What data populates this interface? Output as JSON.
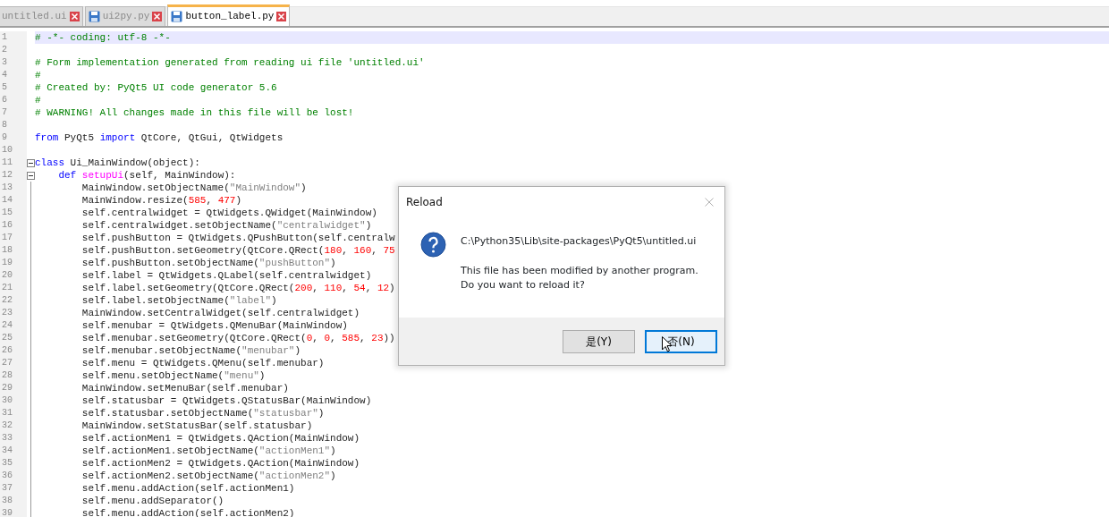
{
  "tabs": [
    {
      "label": "untitled.ui",
      "selected": false,
      "file_icon": false
    },
    {
      "label": "ui2py.py",
      "selected": false,
      "file_icon": true
    },
    {
      "label": "button_label.py",
      "selected": true,
      "file_icon": true
    }
  ],
  "editor": {
    "lines": [
      {
        "number": "1",
        "current": true,
        "segments": [
          {
            "text": "# -*- coding: utf-8 -*-",
            "kind": "comment"
          }
        ]
      },
      {
        "number": "2",
        "current": false
      },
      {
        "number": "3",
        "current": false,
        "segments": [
          {
            "text": "# Form implementation generated from reading ui file 'untitled.ui'",
            "kind": "comment"
          }
        ]
      },
      {
        "number": "4",
        "current": false,
        "segments": [
          {
            "text": "#",
            "kind": "comment"
          }
        ]
      },
      {
        "number": "5",
        "current": false,
        "segments": [
          {
            "text": "# Created by: PyQt5 UI code generator 5.6",
            "kind": "comment"
          }
        ]
      },
      {
        "number": "6",
        "current": false,
        "segments": [
          {
            "text": "#",
            "kind": "comment"
          }
        ]
      },
      {
        "number": "7",
        "current": false,
        "segments": [
          {
            "text": "# WARNING! All changes made in this file will be lost!",
            "kind": "comment"
          }
        ]
      },
      {
        "number": "8",
        "current": false
      },
      {
        "number": "9",
        "current": false,
        "segments": [
          {
            "text": "from",
            "kind": "keyword"
          },
          {
            "text": " PyQt5 ",
            "kind": "plain"
          },
          {
            "text": "import",
            "kind": "keyword"
          },
          {
            "text": " QtCore, QtGui, QtWidgets",
            "kind": "plain"
          }
        ]
      },
      {
        "number": "10",
        "current": false
      },
      {
        "number": "11",
        "current": false,
        "expanded": true,
        "segments": [
          {
            "text": "class",
            "kind": "keyword"
          },
          {
            "text": " Ui_MainWindow(object):",
            "kind": "plain"
          }
        ],
        "children": [
          {
            "number": "12",
            "current": false,
            "expanded": true,
            "segments": [
              {
                "text": "def",
                "kind": "keyword"
              },
              {
                "text": " setupUi",
                "kind": "function"
              },
              {
                "text": "(self, MainWindow):",
                "kind": "plain"
              }
            ],
            "children": [
              {
                "number": "13",
                "current": false,
                "segments": [
                  {
                    "text": "MainWindow.setObjectName(",
                    "kind": "plain"
                  },
                  {
                    "text": "\"MainWindow\"",
                    "kind": "string"
                  },
                  {
                    "text": ")",
                    "kind": "plain"
                  }
                ]
              },
              {
                "number": "14",
                "current": false,
                "segments": [
                  {
                    "text": "MainWindow.resize(",
                    "kind": "plain"
                  },
                  {
                    "text": "585",
                    "kind": "number"
                  },
                  {
                    "text": ", ",
                    "kind": "plain"
                  },
                  {
                    "text": "477",
                    "kind": "number"
                  },
                  {
                    "text": ")",
                    "kind": "plain"
                  }
                ]
              },
              {
                "number": "15",
                "current": false,
                "segments": [
                  {
                    "text": "self.centralwidget = QtWidgets.QWidget(MainWindow)",
                    "kind": "plain"
                  }
                ]
              },
              {
                "number": "16",
                "current": false,
                "segments": [
                  {
                    "text": "self.centralwidget.setObjectName(",
                    "kind": "plain"
                  },
                  {
                    "text": "\"centralwidget\"",
                    "kind": "string"
                  },
                  {
                    "text": ")",
                    "kind": "plain"
                  }
                ]
              },
              {
                "number": "17",
                "current": false,
                "segments": [
                  {
                    "text": "self.pushButton = QtWidgets.QPushButton(self.centralw",
                    "kind": "plain"
                  }
                ]
              },
              {
                "number": "18",
                "current": false,
                "segments": [
                  {
                    "text": "self.pushButton.setGeometry(QtCore.QRect(",
                    "kind": "plain"
                  },
                  {
                    "text": "180",
                    "kind": "number"
                  },
                  {
                    "text": ", ",
                    "kind": "plain"
                  },
                  {
                    "text": "160",
                    "kind": "number"
                  },
                  {
                    "text": ", ",
                    "kind": "plain"
                  },
                  {
                    "text": "75",
                    "kind": "number"
                  }
                ]
              },
              {
                "number": "19",
                "current": false,
                "segments": [
                  {
                    "text": "self.pushButton.setObjectName(",
                    "kind": "plain"
                  },
                  {
                    "text": "\"pushButton\"",
                    "kind": "string"
                  },
                  {
                    "text": ")",
                    "kind": "plain"
                  }
                ]
              },
              {
                "number": "20",
                "current": false,
                "segments": [
                  {
                    "text": "self.label = QtWidgets.QLabel(self.centralwidget)",
                    "kind": "plain"
                  }
                ]
              },
              {
                "number": "21",
                "current": false,
                "segments": [
                  {
                    "text": "self.label.setGeometry(QtCore.QRect(",
                    "kind": "plain"
                  },
                  {
                    "text": "200",
                    "kind": "number"
                  },
                  {
                    "text": ", ",
                    "kind": "plain"
                  },
                  {
                    "text": "110",
                    "kind": "number"
                  },
                  {
                    "text": ", ",
                    "kind": "plain"
                  },
                  {
                    "text": "54",
                    "kind": "number"
                  },
                  {
                    "text": ", ",
                    "kind": "plain"
                  },
                  {
                    "text": "12",
                    "kind": "number"
                  },
                  {
                    "text": ")",
                    "kind": "plain"
                  }
                ]
              },
              {
                "number": "22",
                "current": false,
                "segments": [
                  {
                    "text": "self.label.setObjectName(",
                    "kind": "plain"
                  },
                  {
                    "text": "\"label\"",
                    "kind": "string"
                  },
                  {
                    "text": ")",
                    "kind": "plain"
                  }
                ]
              },
              {
                "number": "23",
                "current": false,
                "segments": [
                  {
                    "text": "MainWindow.setCentralWidget(self.centralwidget)",
                    "kind": "plain"
                  }
                ]
              },
              {
                "number": "24",
                "current": false,
                "segments": [
                  {
                    "text": "self.menubar = QtWidgets.QMenuBar(MainWindow)",
                    "kind": "plain"
                  }
                ]
              },
              {
                "number": "25",
                "current": false,
                "segments": [
                  {
                    "text": "self.menubar.setGeometry(QtCore.QRect(",
                    "kind": "plain"
                  },
                  {
                    "text": "0",
                    "kind": "number"
                  },
                  {
                    "text": ", ",
                    "kind": "plain"
                  },
                  {
                    "text": "0",
                    "kind": "number"
                  },
                  {
                    "text": ", ",
                    "kind": "plain"
                  },
                  {
                    "text": "585",
                    "kind": "number"
                  },
                  {
                    "text": ", ",
                    "kind": "plain"
                  },
                  {
                    "text": "23",
                    "kind": "number"
                  },
                  {
                    "text": "))",
                    "kind": "plain"
                  }
                ]
              },
              {
                "number": "26",
                "current": false,
                "segments": [
                  {
                    "text": "self.menubar.setObjectName(",
                    "kind": "plain"
                  },
                  {
                    "text": "\"menubar\"",
                    "kind": "string"
                  },
                  {
                    "text": ")",
                    "kind": "plain"
                  }
                ]
              },
              {
                "number": "27",
                "current": false,
                "segments": [
                  {
                    "text": "self.menu = QtWidgets.QMenu(self.menubar)",
                    "kind": "plain"
                  }
                ]
              },
              {
                "number": "28",
                "current": false,
                "segments": [
                  {
                    "text": "self.menu.setObjectName(",
                    "kind": "plain"
                  },
                  {
                    "text": "\"menu\"",
                    "kind": "string"
                  },
                  {
                    "text": ")",
                    "kind": "plain"
                  }
                ]
              },
              {
                "number": "29",
                "current": false,
                "segments": [
                  {
                    "text": "MainWindow.setMenuBar(self.menubar)",
                    "kind": "plain"
                  }
                ]
              },
              {
                "number": "30",
                "current": false,
                "segments": [
                  {
                    "text": "self.statusbar = QtWidgets.QStatusBar(MainWindow)",
                    "kind": "plain"
                  }
                ]
              },
              {
                "number": "31",
                "current": false,
                "segments": [
                  {
                    "text": "self.statusbar.setObjectName(",
                    "kind": "plain"
                  },
                  {
                    "text": "\"statusbar\"",
                    "kind": "string"
                  },
                  {
                    "text": ")",
                    "kind": "plain"
                  }
                ]
              },
              {
                "number": "32",
                "current": false,
                "segments": [
                  {
                    "text": "MainWindow.setStatusBar(self.statusbar)",
                    "kind": "plain"
                  }
                ]
              },
              {
                "number": "33",
                "current": false,
                "segments": [
                  {
                    "text": "self.actionMen1 = QtWidgets.QAction(MainWindow)",
                    "kind": "plain"
                  }
                ]
              },
              {
                "number": "34",
                "current": false,
                "segments": [
                  {
                    "text": "self.actionMen1.setObjectName(",
                    "kind": "plain"
                  },
                  {
                    "text": "\"actionMen1\"",
                    "kind": "string"
                  },
                  {
                    "text": ")",
                    "kind": "plain"
                  }
                ]
              },
              {
                "number": "35",
                "current": false,
                "segments": [
                  {
                    "text": "self.actionMen2 = QtWidgets.QAction(MainWindow)",
                    "kind": "plain"
                  }
                ]
              },
              {
                "number": "36",
                "current": false,
                "segments": [
                  {
                    "text": "self.actionMen2.setObjectName(",
                    "kind": "plain"
                  },
                  {
                    "text": "\"actionMen2\"",
                    "kind": "string"
                  },
                  {
                    "text": ")",
                    "kind": "plain"
                  }
                ]
              },
              {
                "number": "37",
                "current": false,
                "segments": [
                  {
                    "text": "self.menu.addAction(self.actionMen1)",
                    "kind": "plain"
                  }
                ]
              },
              {
                "number": "38",
                "current": false,
                "segments": [
                  {
                    "text": "self.menu.addSeparator()",
                    "kind": "plain"
                  }
                ]
              },
              {
                "number": "39",
                "current": false,
                "segments": [
                  {
                    "text": "self.menu.addAction(self.actionMen2)",
                    "kind": "plain"
                  }
                ]
              }
            ]
          }
        ]
      }
    ]
  },
  "dialog": {
    "title": "Reload",
    "path": "C:\\Python35\\Lib\\site-packages\\PyQt5\\untitled.ui",
    "message": [
      "This file has been modified by another program.",
      "Do you want to reload it?"
    ],
    "buttons": [
      {
        "label": "是(Y)",
        "focused": false
      },
      {
        "label": "否(N)",
        "focused": true
      }
    ]
  }
}
